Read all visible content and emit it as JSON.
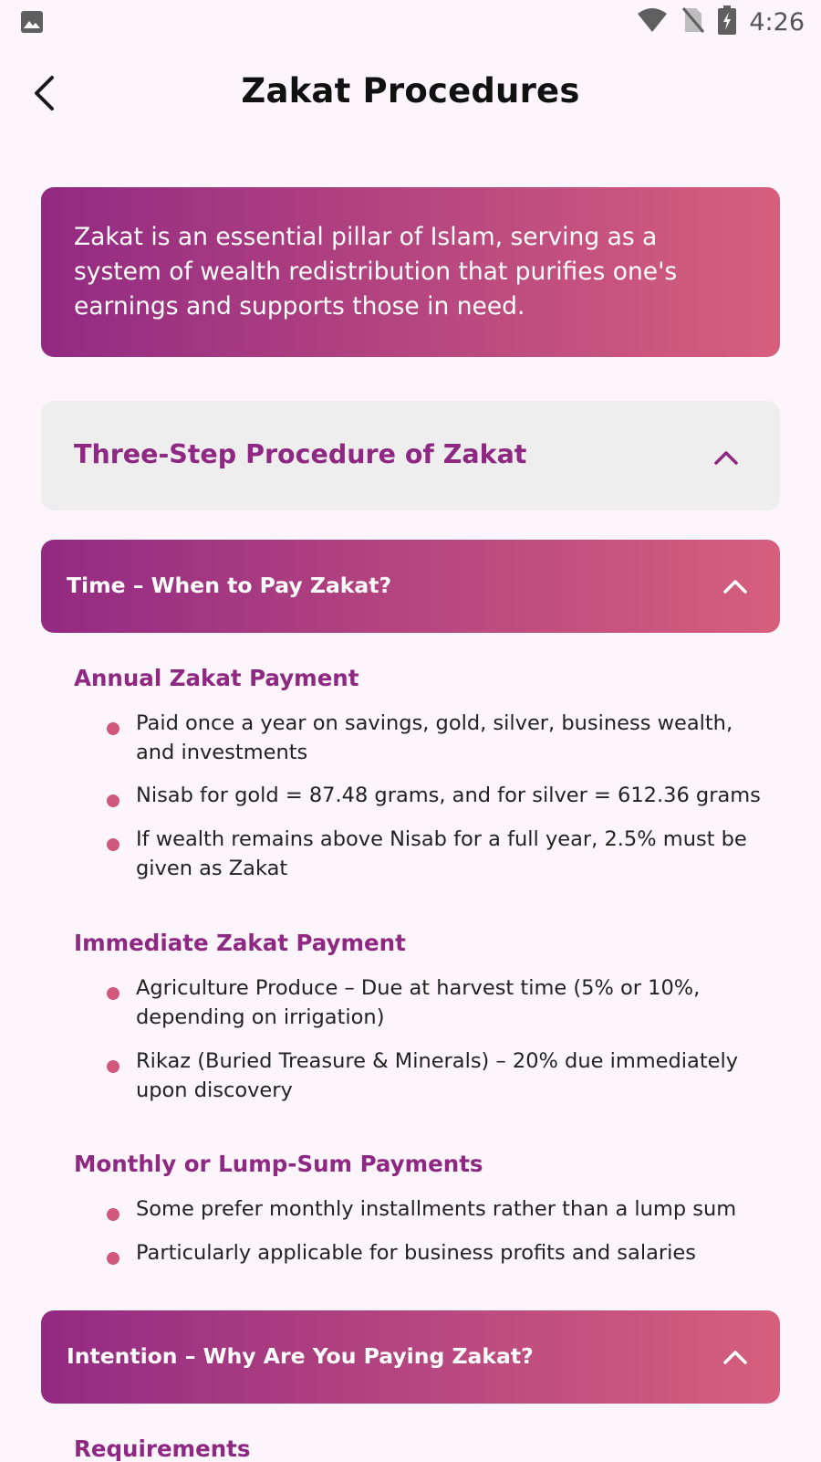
{
  "status_bar": {
    "time": "4:26",
    "icons": [
      "image-icon",
      "wifi-icon",
      "no-sim-icon",
      "battery-charging-icon"
    ]
  },
  "app_bar": {
    "title": "Zakat Procedures",
    "back_icon": "back-arrow-icon"
  },
  "intro": {
    "text": "Zakat is an essential pillar of Islam, serving as a system of wealth redistribution that purifies one's earnings and supports those in need."
  },
  "procedure_section": {
    "title": "Three-Step Procedure of Zakat",
    "expanded": true
  },
  "steps": [
    {
      "title": "Time – When to Pay Zakat?",
      "groups": [
        {
          "title": "Annual Zakat Payment",
          "items": [
            "Paid once a year on savings, gold, silver, business wealth, and investments",
            "Nisab for gold = 87.48 grams, and for silver = 612.36 grams",
            "If wealth remains above Nisab for a full year, 2.5% must be given as Zakat"
          ]
        },
        {
          "title": "Immediate Zakat Payment",
          "items": [
            "Agriculture Produce – Due at harvest time (5% or 10%, depending on irrigation)",
            "Rikaz (Buried Treasure & Minerals) – 20% due immediately upon discovery"
          ]
        },
        {
          "title": "Monthly or Lump-Sum Payments",
          "items": [
            "Some prefer monthly installments rather than a lump sum",
            "Particularly applicable for business profits and salaries"
          ]
        }
      ]
    },
    {
      "title": "Intention – Why Are You Paying Zakat?",
      "groups": [
        {
          "title": "Requirements",
          "items": []
        }
      ]
    }
  ],
  "colors": {
    "background": "#FCF6FC",
    "accent": "#8E2882",
    "gradient_start": "#922A82",
    "gradient_end": "#D65F7D",
    "bullet": "#D0587C",
    "section_bg": "#EEEEEE"
  }
}
